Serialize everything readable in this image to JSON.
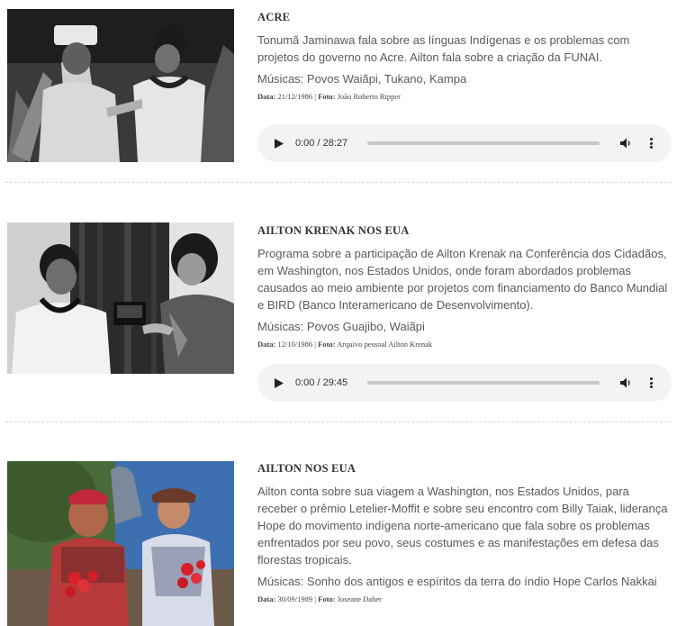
{
  "entries": [
    {
      "title": "ACRE",
      "description": "Tonumã Jaminawa fala sobre as línguas Indígenas e os problemas com projetos do governo no Acre. Ailton fala sobre a criação da FUNAI.",
      "musicas": "Músicas: Povos Waiãpi, Tukano, Kampa",
      "data_label": "Data:",
      "data_value": "21/12/1986",
      "foto_label": "Foto:",
      "foto_value": "João Roberto Ripper",
      "player": {
        "time": "0:00 / 28:27",
        "progress": 0
      }
    },
    {
      "title": "AILTON KRENAK NOS EUA",
      "description": "Programa sobre a participação de Ailton Krenak na Conferência dos Cidadãos, em Washington, nos Estados Unidos, onde foram abordados problemas causados ao meio ambiente por projetos com financiamento do Banco Mundial e BIRD (Banco Interamericano de Desenvolvimento).",
      "musicas": "Músicas: Povos Guajibo, Waiãpi",
      "data_label": "Data:",
      "data_value": "12/10/1986",
      "foto_label": "Foto:",
      "foto_value": "Arquivo pessoal Ailton Krenak",
      "player": {
        "time": "0:00 / 29:45",
        "progress": 0
      }
    },
    {
      "title": "AILTON NOS EUA",
      "description": "Ailton conta sobre sua viagem a Washington, nos Estados Unidos, para receber o prêmio Letelier-Moffit e sobre seu encontro com Billy Taiak, liderança Hope do movimento indígena norte-americano que fala sobre os problemas enfrentados por seu povo, seus costumes e as manifestações em defesa das florestas tropicais.",
      "musicas": "Músicas: Sonho dos antigos e espíritos da terra do índio Hope Carlos Nakkai",
      "data_label": "Data:",
      "data_value": "30/09/1989",
      "foto_label": "Foto:",
      "foto_value": "Joseane Daher"
    }
  ],
  "icons": {
    "play": "play-icon",
    "volume": "volume-icon",
    "menu": "more-vert-icon"
  },
  "colors": {
    "player_bg": "#f1f3f4",
    "text": "#5a5a5a",
    "title": "#333333"
  }
}
